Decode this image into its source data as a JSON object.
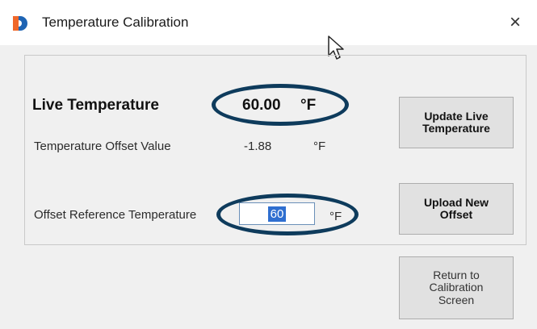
{
  "window": {
    "title": "Temperature Calibration",
    "close_glyph": "×"
  },
  "live": {
    "label": "Live Temperature",
    "value": "60.00",
    "unit": "°F"
  },
  "offset": {
    "label": "Temperature Offset Value",
    "value": "-1.88",
    "unit": "°F"
  },
  "reference": {
    "label": "Offset Reference Temperature",
    "value": "60",
    "unit": "°F"
  },
  "buttons": {
    "update_live": "Update Live\nTemperature",
    "upload_offset": "Upload New\nOffset",
    "return_calibration": "Return to\nCalibration\nScreen"
  },
  "colors": {
    "highlight_ellipse": "#0e3b5c",
    "selection": "#2f6fd0",
    "app_icon_orange": "#f0682a",
    "app_icon_blue": "#1e64b4"
  },
  "icons": {
    "app": "app-logo-icon",
    "close": "close-icon",
    "cursor": "mouse-pointer-icon"
  }
}
